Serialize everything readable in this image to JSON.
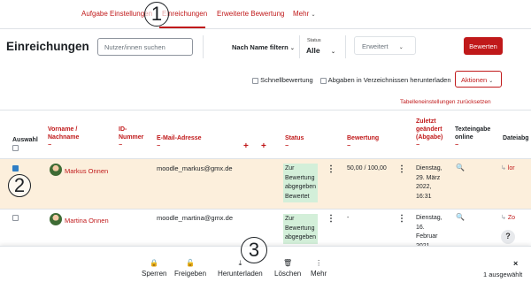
{
  "nav": {
    "tabs": [
      "Aufgabe",
      "Einstellungen",
      "Einreichungen",
      "Erweiterte Bewertung",
      "Mehr"
    ],
    "more_chevron": "⌄"
  },
  "annotations": [
    "1",
    "2",
    "3"
  ],
  "header": {
    "title": "Einreichungen",
    "search_placeholder": "Nutzer/innen suchen",
    "name_filter_label": "Nach Name filtern",
    "status_label": "Status",
    "status_value": "Alle",
    "advanced_label": "Erweitert",
    "grade_button": "Bewerten"
  },
  "options": {
    "quick_grading": "Schnellbewertung",
    "download_folders": "Abgaben in Verzeichnissen herunterladen",
    "actions_label": "Aktionen",
    "reset_table": "Tabelleneinstellungen zurücksetzen"
  },
  "table": {
    "headers": {
      "select": "Auswahl",
      "name": "Vorname / Nachname",
      "id": "ID-Nummer",
      "email": "E-Mail-Adresse",
      "status": "Status",
      "grade": "Bewertung",
      "modified": "Zuletzt geändert (Abgabe)",
      "online_text": "Texteingabe online",
      "files": "Dateiabg",
      "dash": "−",
      "plus": "+"
    },
    "rows": [
      {
        "name": "Markus Onnen",
        "email": "moodle_markus@gmx.de",
        "status_lines": [
          "Zur",
          "Bewertung",
          "abgegeben",
          "Bewertet"
        ],
        "grade": "50,00 / 100,00",
        "date_lines": [
          "Dienstag,",
          "29. März",
          "2022,",
          "16:31"
        ],
        "file_prefix": "↳",
        "file_name": "lor",
        "selected": true
      },
      {
        "name": "Martina Onnen",
        "email": "moodle_martina@gmx.de",
        "status_lines": [
          "Zur",
          "Bewertung",
          "abgegeben"
        ],
        "grade": "-",
        "date_lines": [
          "Dienstag,",
          "16.",
          "Februar",
          "2021,"
        ],
        "file_prefix": "↳",
        "file_name": "Zo",
        "selected": false
      }
    ]
  },
  "help_label": "?",
  "bottom_bar": {
    "actions": [
      {
        "label": "Sperren",
        "icon": "lock-icon",
        "glyph": "🔒"
      },
      {
        "label": "Freigeben",
        "icon": "unlock-icon",
        "glyph": "🔓"
      },
      {
        "label": "Herunterladen",
        "icon": "download-icon",
        "glyph": "⤓"
      },
      {
        "label": "Löschen",
        "icon": "trash-icon",
        "glyph": "🗑"
      },
      {
        "label": "Mehr",
        "icon": "more-vertical-icon",
        "glyph": "⋮"
      }
    ],
    "close_glyph": "×",
    "selected_count": "1 ausgewählt"
  },
  "colors": {
    "accent": "#c0191a",
    "selected_row": "#fcefdc",
    "status_badge": "#d3efd9"
  }
}
